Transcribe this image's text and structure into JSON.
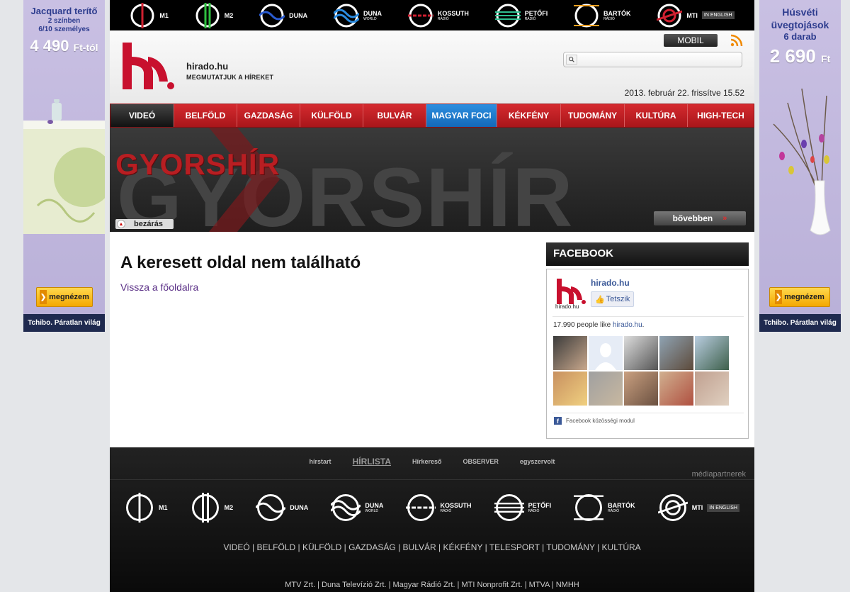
{
  "left_ad": {
    "title": "Jacquard terítő",
    "line1": "2 színben",
    "line2": "6/10 személyes",
    "price": "4 490",
    "price_suffix": "Ft-tól",
    "button": "megnézem",
    "footer": "Tchibo. Páratlan világ"
  },
  "right_ad": {
    "title": "Húsvéti üvegtojások",
    "line1": "6 darab",
    "price": "2 690",
    "price_suffix": "Ft",
    "button": "megnézem",
    "footer": "Tchibo. Páratlan világ"
  },
  "channels": [
    {
      "name": "M1",
      "sub": ""
    },
    {
      "name": "M2",
      "sub": ""
    },
    {
      "name": "DUNA",
      "sub": ""
    },
    {
      "name": "DUNA",
      "sub": "WORLD"
    },
    {
      "name": "KOSSUTH",
      "sub": "RÁDIÓ"
    },
    {
      "name": "PETŐFI",
      "sub": "RÁDIÓ"
    },
    {
      "name": "BARTÓK",
      "sub": "RÁDIÓ"
    },
    {
      "name": "MTI",
      "sub": ""
    }
  ],
  "in_english": "IN ENGLISH",
  "header": {
    "site_name": "hirado.hu",
    "slogan": "MEGMUTATJUK A HÍREKET",
    "mobil": "MOBIL",
    "search_placeholder": "",
    "date": "2013. február 22. frissítve 15.52"
  },
  "nav": [
    "VIDEÓ",
    "BELFÖLD",
    "GAZDASÁG",
    "KÜLFÖLD",
    "BULVÁR",
    "MAGYAR FOCI",
    "KÉKFÉNY",
    "TUDOMÁNY",
    "KULTÚRA",
    "HIGH-TECH"
  ],
  "banner": {
    "title": "GYORSHÍR",
    "background_text": "GYORSHÍR",
    "close": "bezárás",
    "more": "bővebben"
  },
  "content": {
    "title": "A keresett oldal nem található",
    "back_link": "Vissza a főoldalra"
  },
  "facebook": {
    "header": "FACEBOOK",
    "page_name": "hirado.hu",
    "logo_text": "hirado.hu",
    "like_button": "Tetszik",
    "count_prefix": "17.990 people like ",
    "count_link": "hirado.hu",
    "count_suffix": ".",
    "module": "Facebook közösségi modul"
  },
  "footer": {
    "partners": [
      "hírstart",
      "HÍRLISTA",
      "Hírkereső",
      "OBSERVER",
      "egyszervolt"
    ],
    "partners_label": "médiapartnerek",
    "nav": "VIDEÓ | BELFÖLD | KÜLFÖLD | GAZDASÁG | BULVÁR | KÉKFÉNY | TELESPORT | TUDOMÁNY | KULTÚRA",
    "companies": "MTV Zrt. | Duna Televízió Zrt. | Magyar Rádió Zrt. | MTI Nonprofit Zrt. | MTVA | NMHH"
  },
  "colors": {
    "brand_red": "#b31b1f",
    "foci_blue": "#1e7fd3",
    "facebook_blue": "#3b5998"
  }
}
